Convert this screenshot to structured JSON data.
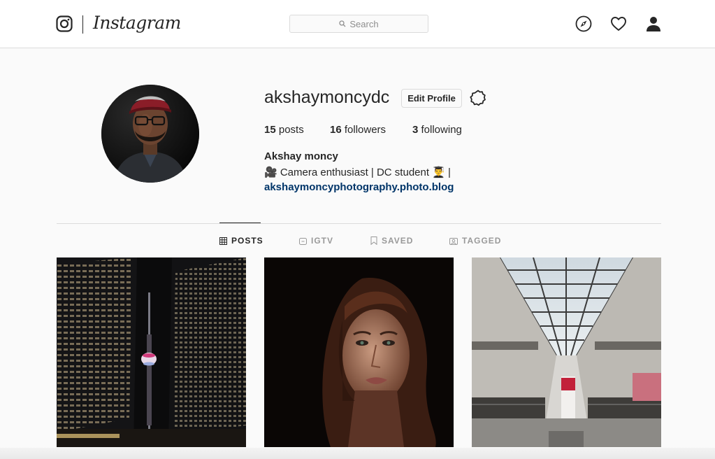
{
  "brand": {
    "name": "Instagram"
  },
  "search": {
    "placeholder": "Search"
  },
  "profile": {
    "username": "akshaymoncydc",
    "edit_label": "Edit Profile",
    "stats": {
      "posts_count": "15",
      "posts_label": " posts",
      "followers_count": "16",
      "followers_label": " followers",
      "following_count": "3",
      "following_label": " following"
    },
    "full_name": "Akshay moncy",
    "bio": "🎥  Camera enthusiast | DC student 👨‍🎓  |",
    "link": "akshaymoncyphotography.photo.blog"
  },
  "tabs": [
    {
      "label": "POSTS",
      "icon": "grid-icon",
      "active": true
    },
    {
      "label": "IGTV",
      "icon": "igtv-icon",
      "active": false
    },
    {
      "label": "SAVED",
      "icon": "bookmark-icon",
      "active": false
    },
    {
      "label": "TAGGED",
      "icon": "tagged-icon",
      "active": false
    }
  ],
  "posts": [
    {
      "subject": "city-tower-night"
    },
    {
      "subject": "portrait-woman"
    },
    {
      "subject": "mall-skylight"
    }
  ],
  "colors": {
    "text": "#262626",
    "muted": "#8e8e8e",
    "border": "#dbdbdb",
    "link": "#003569",
    "background": "#fafafa"
  }
}
